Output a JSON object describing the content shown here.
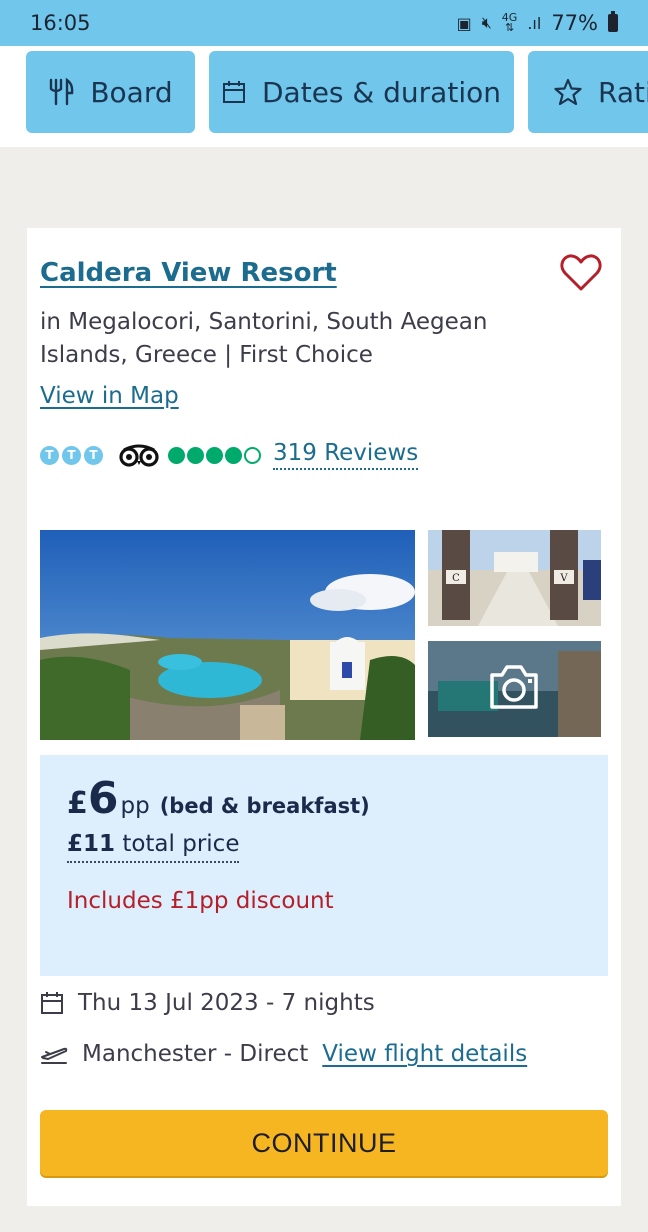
{
  "status_bar": {
    "time": "16:05",
    "network": "4G",
    "battery": "77%",
    "icons": [
      "notification-icon",
      "mute-icon",
      "signal-icon",
      "battery-icon"
    ]
  },
  "filters": [
    {
      "label": "Board",
      "icon": "cutlery-icon"
    },
    {
      "label": "Dates & duration",
      "icon": "calendar-icon"
    },
    {
      "label": "Rati",
      "icon": "star-icon"
    }
  ],
  "hotel": {
    "name": "Caldera View Resort",
    "location": "in Megalocori, Santorini, South Aegean Islands, Greece | First Choice",
    "map_link": "View in Map",
    "rating_badge_letters": [
      "T",
      "T",
      "T"
    ],
    "tripadvisor_rating": 4,
    "tripadvisor_max": 5,
    "reviews": "319 Reviews"
  },
  "price": {
    "currency": "£",
    "amount": "6",
    "per": "pp",
    "board": "(bed & breakfast)",
    "total_amount": "£11",
    "total_label": "total price",
    "discount": "Includes £1pp discount"
  },
  "trip": {
    "dates": "Thu 13 Jul 2023 - 7 nights",
    "flight": "Manchester - Direct",
    "flight_link": "View flight details"
  },
  "continue_label": "CONTINUE",
  "colors": {
    "accent": "#71c6ec",
    "link": "#1b6c8f",
    "button": "#f5b622",
    "discount": "#b41f2a",
    "tripadvisor": "#00aa6c"
  }
}
